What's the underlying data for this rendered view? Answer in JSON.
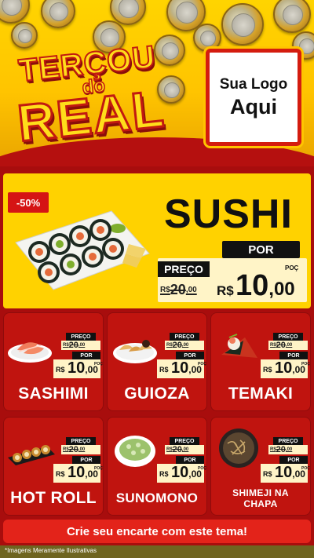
{
  "header": {
    "title_line1": "TERÇOU",
    "title_do": "do",
    "title_line2": "REAL",
    "logo_line1": "Sua Logo",
    "logo_line2": "Aqui"
  },
  "hero": {
    "discount": "-50%",
    "name": "SUSHI",
    "por_label": "POR",
    "preco_label": "PREÇO",
    "old_prefix": "R$",
    "old_price": "20",
    "old_cents": ",00",
    "currency": "R$",
    "new_price": "10",
    "new_cents": ",00",
    "poc": "POÇ"
  },
  "products": [
    {
      "name": "SASHIMI",
      "preco_label": "PREÇO",
      "old_prefix": "R$",
      "old_price": "20",
      "old_cents": ",00",
      "por_label": "POR",
      "currency": "R$",
      "new_price": "10",
      "new_cents": ",00",
      "poc": "POÇ"
    },
    {
      "name": "GUIOZA",
      "preco_label": "PREÇO",
      "old_prefix": "R$",
      "old_price": "20",
      "old_cents": ",00",
      "por_label": "POR",
      "currency": "R$",
      "new_price": "10",
      "new_cents": ",00",
      "poc": "POÇ"
    },
    {
      "name": "TEMAKI",
      "preco_label": "PREÇO",
      "old_prefix": "R$",
      "old_price": "20",
      "old_cents": ",00",
      "por_label": "POR",
      "currency": "R$",
      "new_price": "10",
      "new_cents": ",00",
      "poc": "POÇ"
    },
    {
      "name": "HOT ROLL",
      "preco_label": "PREÇO",
      "old_prefix": "R$",
      "old_price": "20",
      "old_cents": ",00",
      "por_label": "POR",
      "currency": "R$",
      "new_price": "10",
      "new_cents": ",00",
      "poc": "POÇ"
    },
    {
      "name": "SUNOMONO",
      "preco_label": "PREÇO",
      "old_prefix": "R$",
      "old_price": "20",
      "old_cents": ",00",
      "por_label": "POR",
      "currency": "R$",
      "new_price": "10",
      "new_cents": ",00",
      "poc": "POÇ"
    },
    {
      "name": "SHIMEJI NA CHAPA",
      "name_line1": "SHIMEJI NA",
      "name_line2": "CHAPA",
      "preco_label": "PREÇO",
      "old_prefix": "R$",
      "old_price": "20",
      "old_cents": ",00",
      "por_label": "POR",
      "currency": "R$",
      "new_price": "10",
      "new_cents": ",00",
      "poc": "POÇ"
    }
  ],
  "footer": {
    "cta": "Crie seu encarte com este tema!",
    "disclaimer": "*Imagens Meramente Ilustrativas"
  },
  "colors": {
    "background": "#a80d0d",
    "header_yellow": "#ffd200",
    "card_red": "#c0140f",
    "cta_red": "#e3231a"
  }
}
